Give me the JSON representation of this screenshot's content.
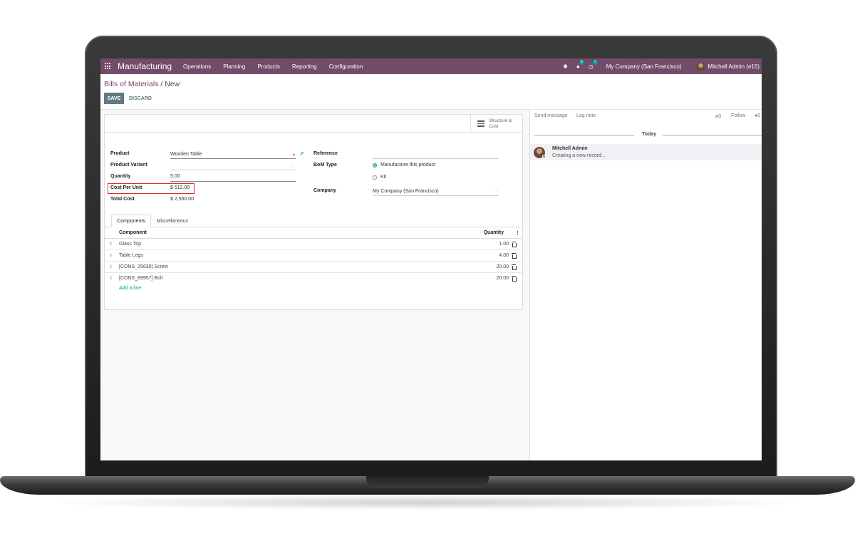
{
  "navbar": {
    "app_name": "Manufacturing",
    "menu": [
      "Operations",
      "Planning",
      "Products",
      "Reporting",
      "Configuration"
    ],
    "messages_count": "6",
    "activities_count": "7",
    "company": "My Company (San Francisco)",
    "user": "Mitchell Admin (e15)"
  },
  "breadcrumb": {
    "parent": "Bills of Materials",
    "separator": " / ",
    "current": "New"
  },
  "actions": {
    "save": "SAVE",
    "discard": "DISCARD"
  },
  "stat_button": {
    "line1": "Structure &",
    "line2": "Cost"
  },
  "form": {
    "product_label": "Product",
    "product_value": "Wooden Table",
    "variant_label": "Product Variant",
    "quantity_label": "Quantity",
    "quantity_value": "5.00",
    "cost_per_unit_label": "Cost Per Unit",
    "cost_per_unit_value": "$ 512.00",
    "total_cost_label": "Total Cost",
    "total_cost_value": "$ 2,560.00",
    "reference_label": "Reference",
    "bom_type_label": "BoM Type",
    "bom_type_options": [
      "Manufacture this product",
      "Kit"
    ],
    "bom_type_selected": "Manufacture this product",
    "company_label": "Company",
    "company_value": "My Company (San Francisco)"
  },
  "tabs": [
    "Components",
    "Miscellaneous"
  ],
  "components": {
    "headers": {
      "component": "Component",
      "quantity": "Quantity"
    },
    "rows": [
      {
        "name": "Glass Top",
        "qty": "1.00"
      },
      {
        "name": "Table Legs",
        "qty": "4.00"
      },
      {
        "name": "[CONS_25630] Screw",
        "qty": "20.00"
      },
      {
        "name": "[CONS_89957] Bolt",
        "qty": "20.00"
      }
    ],
    "add_line": "Add a line"
  },
  "chatter": {
    "send_message": "Send message",
    "log_note": "Log note",
    "attachments_count": "0",
    "follow": "Follow",
    "followers_count": "0",
    "date_separator": "Today",
    "message": {
      "author": "Mitchell Admin",
      "body": "Creating a new record..."
    }
  },
  "colors": {
    "brand": "#714b67",
    "accent": "#00a09d",
    "button": "#5f7b81",
    "highlight": "#d9312b"
  }
}
